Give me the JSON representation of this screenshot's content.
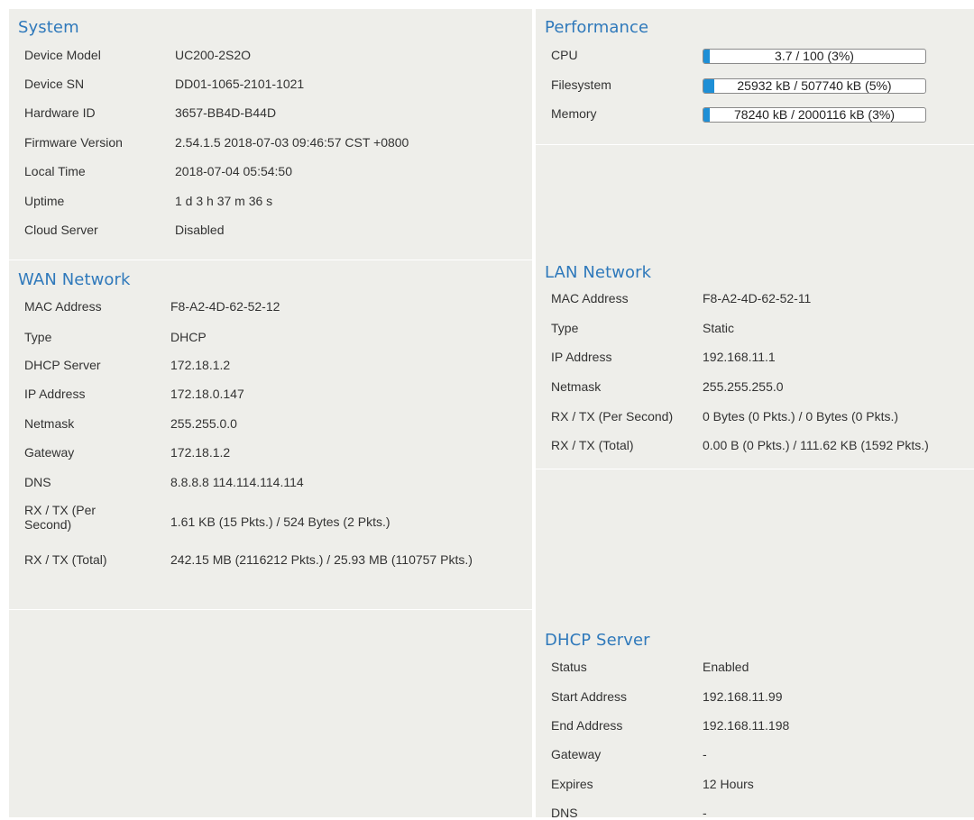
{
  "system": {
    "title": "System",
    "rows": [
      {
        "label": "Device Model",
        "value": "UC200-2S2O"
      },
      {
        "label": "Device SN",
        "value": "DD01-1065-2101-1021"
      },
      {
        "label": "Hardware ID",
        "value": "3657-BB4D-B44D"
      },
      {
        "label": "Firmware Version",
        "value": "2.54.1.5 2018-07-03 09:46:57 CST +0800"
      },
      {
        "label": "Local Time",
        "value": "2018-07-04 05:54:50"
      },
      {
        "label": "Uptime",
        "value": "1 d 3 h 37 m 36 s"
      },
      {
        "label": "Cloud Server",
        "value": "Disabled"
      }
    ]
  },
  "performance": {
    "title": "Performance",
    "rows": [
      {
        "label": "CPU",
        "value": "3.7 / 100 (3%)",
        "fraction": 0.03
      },
      {
        "label": "Filesystem",
        "value": "25932 kB / 507740 kB (5%)",
        "fraction": 0.05
      },
      {
        "label": "Memory",
        "value": "78240 kB / 2000116 kB (3%)",
        "fraction": 0.03
      }
    ],
    "bar_color": "#1e8fd6"
  },
  "wan": {
    "title": "WAN Network",
    "rows": [
      {
        "label": "MAC Address",
        "value": "F8-A2-4D-62-52-12"
      },
      {
        "label": "Type",
        "value": "DHCP"
      },
      {
        "label": "DHCP Server",
        "value": "172.18.1.2"
      },
      {
        "label": "IP Address",
        "value": "172.18.0.147"
      },
      {
        "label": "Netmask",
        "value": "255.255.0.0"
      },
      {
        "label": "Gateway",
        "value": "172.18.1.2"
      },
      {
        "label": "DNS",
        "value": "8.8.8.8 114.114.114.114"
      },
      {
        "label": "RX / TX (Per Second)",
        "value": "1.61 KB (15 Pkts.) / 524 Bytes (2 Pkts.)"
      },
      {
        "label": "RX / TX (Total)",
        "value": "242.15 MB (2116212 Pkts.) / 25.93 MB (110757 Pkts.)"
      }
    ]
  },
  "lan": {
    "title": "LAN Network",
    "rows": [
      {
        "label": "MAC Address",
        "value": "F8-A2-4D-62-52-11"
      },
      {
        "label": "Type",
        "value": "Static"
      },
      {
        "label": "IP Address",
        "value": "192.168.11.1"
      },
      {
        "label": "Netmask",
        "value": "255.255.255.0"
      },
      {
        "label": "RX / TX (Per Second)",
        "value": "0 Bytes (0 Pkts.) / 0 Bytes (0 Pkts.)"
      },
      {
        "label": "RX / TX (Total)",
        "value": "0.00 B (0 Pkts.) / 111.62 KB (1592 Pkts.)"
      }
    ]
  },
  "dhcp": {
    "title": "DHCP Server",
    "rows": [
      {
        "label": "Status",
        "value": "Enabled"
      },
      {
        "label": "Start Address",
        "value": "192.168.11.99"
      },
      {
        "label": "End Address",
        "value": "192.168.11.198"
      },
      {
        "label": "Gateway",
        "value": "-"
      },
      {
        "label": "Expires",
        "value": "12 Hours"
      },
      {
        "label": "DNS",
        "value": "-"
      }
    ]
  },
  "colors": {
    "panel_bg": "#eeeeea",
    "title": "#2f79bb",
    "text": "#333333"
  }
}
